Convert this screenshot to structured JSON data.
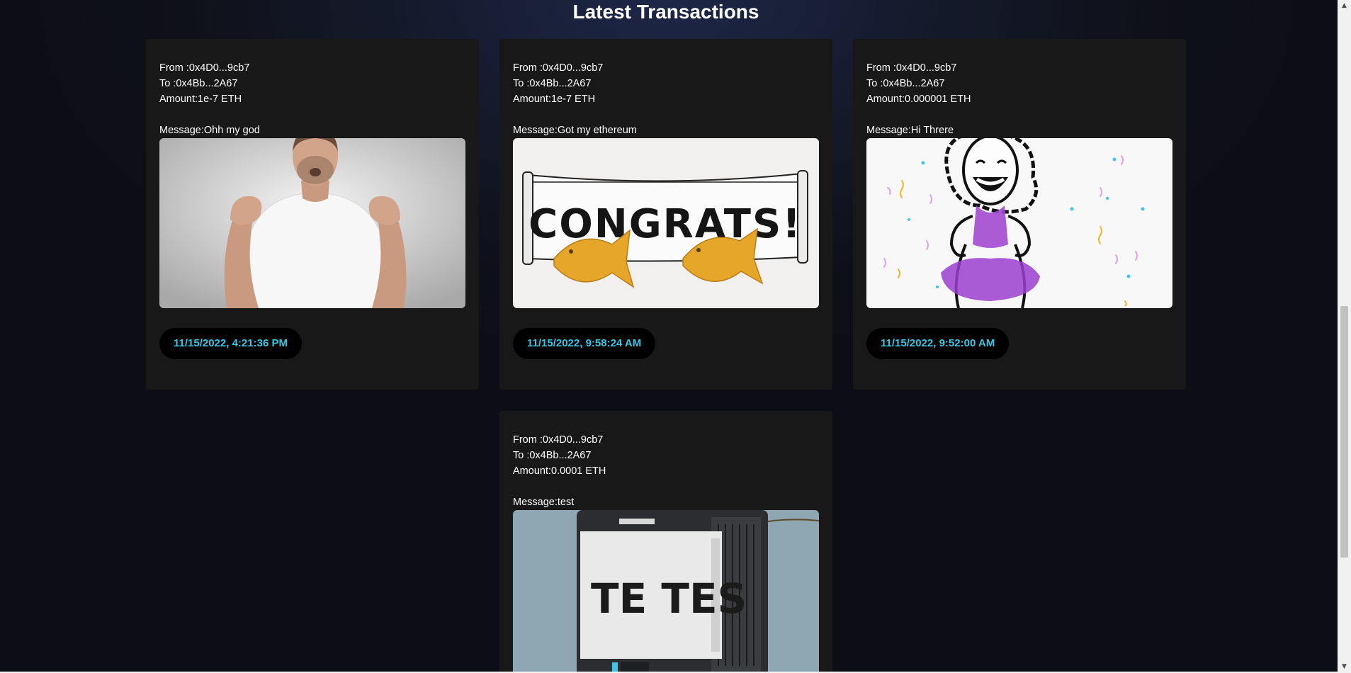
{
  "page": {
    "title": "Latest Transactions"
  },
  "transactions": [
    {
      "from": "From :0x4D0...9cb7",
      "to": "To :0x4Bb...2A67",
      "amount": "Amount:1e-7 ETH",
      "message": "Message:Ohh my god",
      "gif_icon": "man-reaction-gif",
      "timestamp": "11/15/2022, 4:21:36 PM"
    },
    {
      "from": "From :0x4D0...9cb7",
      "to": "To :0x4Bb...2A67",
      "amount": "Amount:1e-7 ETH",
      "message": "Message:Got my ethereum",
      "gif_icon": "congrats-banner-gif",
      "gif_text": "CONGRATS!",
      "timestamp": "11/15/2022, 9:58:24 AM"
    },
    {
      "from": "From :0x4D0...9cb7",
      "to": "To :0x4Bb...2A67",
      "amount": "Amount:0.000001 ETH",
      "message": "Message:Hi Threre",
      "gif_icon": "celebrating-girl-gif",
      "timestamp": "11/15/2022, 9:52:00 AM"
    },
    {
      "from": "From :0x4D0...9cb7",
      "to": "To :0x4Bb...2A67",
      "amount": "Amount:0.0001 ETH",
      "message": "Message:test",
      "gif_icon": "printer-test-gif",
      "gif_text": "TE TES",
      "timestamp": ""
    }
  ],
  "colors": {
    "card_bg": "#181818",
    "timestamp_text": "#37c7e6",
    "timestamp_bg": "#000000",
    "text": "#ffffff"
  }
}
